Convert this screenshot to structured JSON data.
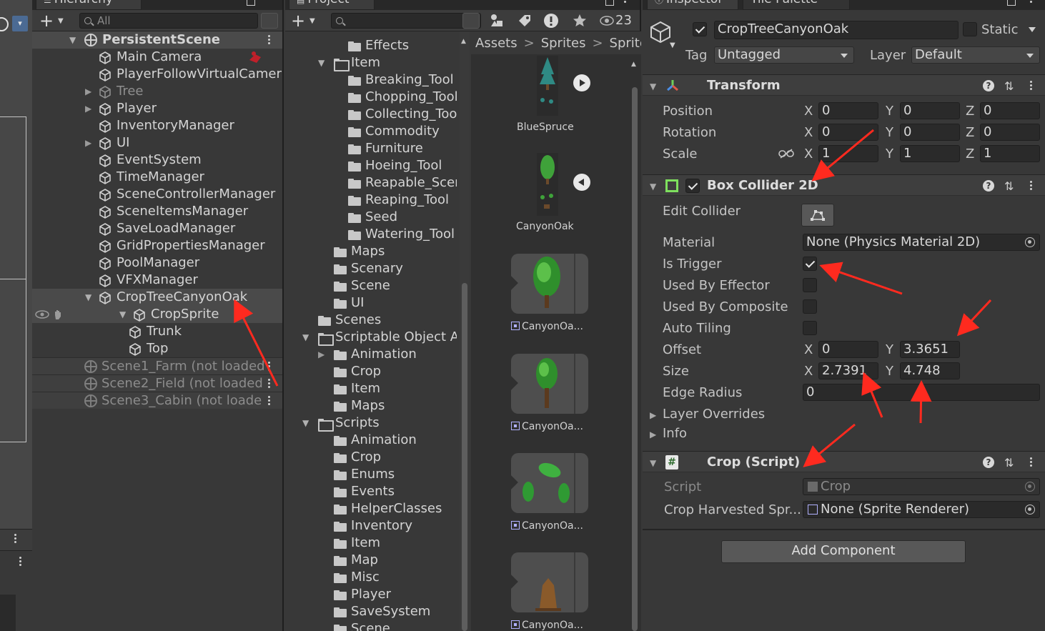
{
  "hierarchy": {
    "tab_label": "Hierarchy",
    "search_placeholder": "All",
    "scene_name": "PersistentScene",
    "items": [
      {
        "label": "Main Camera"
      },
      {
        "label": "PlayerFollowVirtualCamera"
      },
      {
        "label": "Tree"
      },
      {
        "label": "Player"
      },
      {
        "label": "InventoryManager"
      },
      {
        "label": "UI"
      },
      {
        "label": "EventSystem"
      },
      {
        "label": "TimeManager"
      },
      {
        "label": "SceneControllerManager"
      },
      {
        "label": "SceneItemsManager"
      },
      {
        "label": "SaveLoadManager"
      },
      {
        "label": "GridPropertiesManager"
      },
      {
        "label": "PoolManager"
      },
      {
        "label": "VFXManager"
      },
      {
        "label": "CropTreeCanyonOak"
      },
      {
        "label": "CropSprite"
      },
      {
        "label": "Trunk"
      },
      {
        "label": "Top"
      }
    ],
    "unloaded_scenes": [
      {
        "label": "Scene1_Farm (not loaded"
      },
      {
        "label": "Scene2_Field (not loaded"
      },
      {
        "label": "Scene3_Cabin (not loade"
      }
    ]
  },
  "project": {
    "tab_label": "Project",
    "hidden_count": "23",
    "breadcrumb": [
      "Assets",
      "Sprites",
      "Sprite"
    ],
    "tree": [
      {
        "label": "Effects"
      },
      {
        "label": "Item"
      },
      {
        "label": "Breaking_Tool"
      },
      {
        "label": "Chopping_Tool"
      },
      {
        "label": "Collecting_Tool"
      },
      {
        "label": "Commodity"
      },
      {
        "label": "Furniture"
      },
      {
        "label": "Hoeing_Tool"
      },
      {
        "label": "Reapable_Scenary"
      },
      {
        "label": "Reaping_Tool"
      },
      {
        "label": "Seed"
      },
      {
        "label": "Watering_Tool"
      },
      {
        "label": "Maps"
      },
      {
        "label": "Scenary"
      },
      {
        "label": "Scene"
      },
      {
        "label": "UI"
      },
      {
        "label": "Scenes"
      },
      {
        "label": "Scriptable Object Assets"
      },
      {
        "label": "Animation"
      },
      {
        "label": "Crop"
      },
      {
        "label": "Item"
      },
      {
        "label": "Maps"
      },
      {
        "label": "Scripts"
      },
      {
        "label": "Animation"
      },
      {
        "label": "Crop"
      },
      {
        "label": "Enums"
      },
      {
        "label": "Events"
      },
      {
        "label": "HelperClasses"
      },
      {
        "label": "Inventory"
      },
      {
        "label": "Item"
      },
      {
        "label": "Map"
      },
      {
        "label": "Misc"
      },
      {
        "label": "Player"
      },
      {
        "label": "SaveSystem"
      },
      {
        "label": "Scene"
      }
    ],
    "assets": [
      {
        "label": "BlueSpruce"
      },
      {
        "label": "CanyonOak"
      },
      {
        "label": "CanyonOa..."
      },
      {
        "label": "CanyonOa..."
      },
      {
        "label": "CanyonOa..."
      },
      {
        "label": "CanyonOa..."
      }
    ]
  },
  "inspector": {
    "tab_label": "Inspector",
    "tab2_label": "Tile Palette",
    "object_name": "CropTreeCanyonOak",
    "static_label": "Static",
    "tag_label": "Tag",
    "tag_value": "Untagged",
    "layer_label": "Layer",
    "layer_value": "Default",
    "transform": {
      "title": "Transform",
      "position": {
        "label": "Position",
        "x": "0",
        "y": "0",
        "z": "0"
      },
      "rotation": {
        "label": "Rotation",
        "x": "0",
        "y": "0",
        "z": "0"
      },
      "scale": {
        "label": "Scale",
        "x": "1",
        "y": "1",
        "z": "1"
      }
    },
    "box_collider": {
      "title": "Box Collider 2D",
      "edit_collider": "Edit Collider",
      "material_label": "Material",
      "material_value": "None (Physics Material 2D)",
      "is_trigger": "Is Trigger",
      "used_by_effector": "Used By Effector",
      "used_by_composite": "Used By Composite",
      "auto_tiling": "Auto Tiling",
      "offset": {
        "label": "Offset",
        "x": "0",
        "y": "3.3651"
      },
      "size": {
        "label": "Size",
        "x": "2.7391",
        "y": "4.748"
      },
      "edge_radius": {
        "label": "Edge Radius",
        "value": "0"
      },
      "layer_overrides": "Layer Overrides",
      "info": "Info"
    },
    "crop_script": {
      "title": "Crop (Script)",
      "script_label": "Script",
      "script_value": "Crop",
      "harvested_label": "Crop Harvested Spr...",
      "harvested_value": "None (Sprite Renderer)"
    },
    "add_component": "Add Component",
    "axis": {
      "x": "X",
      "y": "Y",
      "z": "Z"
    }
  },
  "colors": {
    "accent_arrow": "#ff2a1f",
    "selection": "#4a4a4a",
    "field": "#2a2a2a"
  }
}
